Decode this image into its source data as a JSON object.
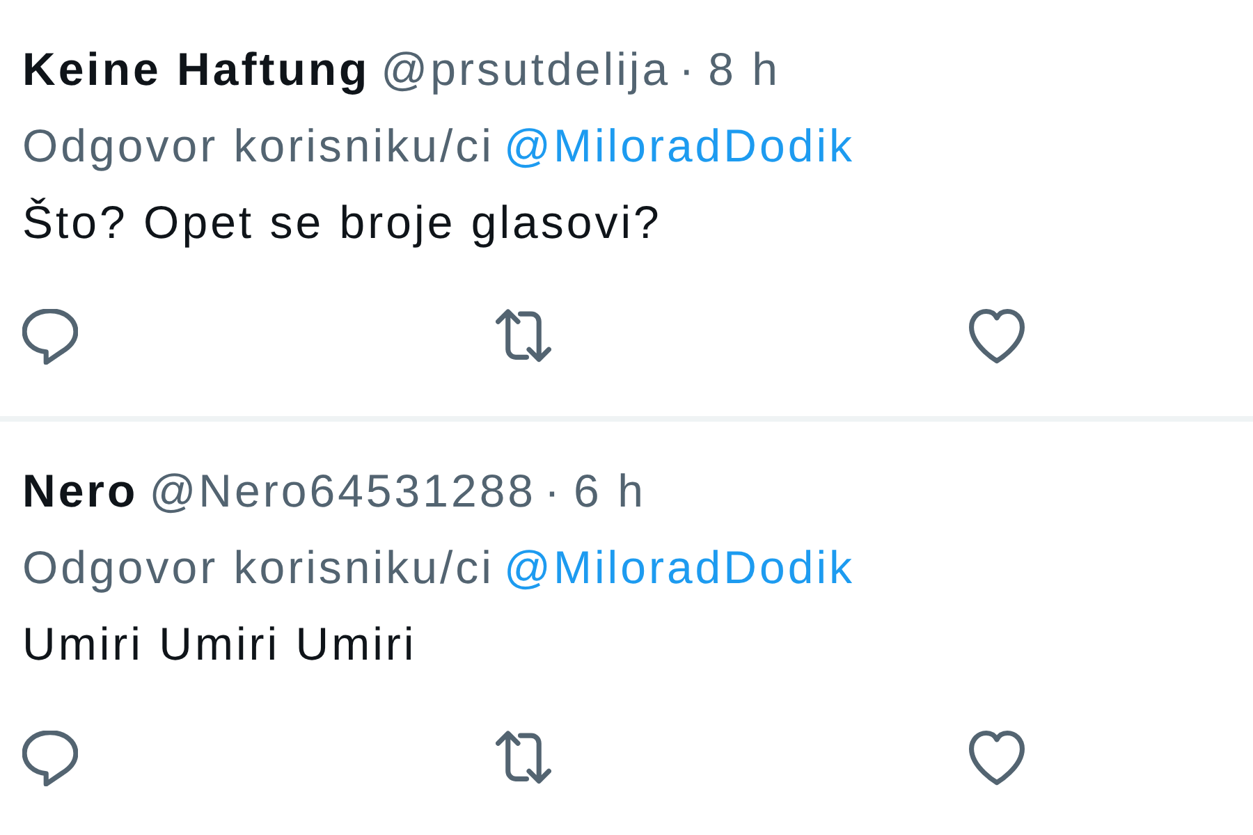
{
  "tweets": [
    {
      "name": "Keine Haftung",
      "handle": "@prsutdelija",
      "separator": "·",
      "time": "8 h",
      "reply_label": "Odgovor korisniku/ci",
      "reply_to": "@MiloradDodik",
      "text": "Što? Opet se broje glasovi?"
    },
    {
      "name": "Nero",
      "handle": "@Nero64531288",
      "separator": "·",
      "time": "6 h",
      "reply_label": "Odgovor korisniku/ci",
      "reply_to": "@MiloradDodik",
      "text": "Umiri Umiri Umiri"
    }
  ]
}
